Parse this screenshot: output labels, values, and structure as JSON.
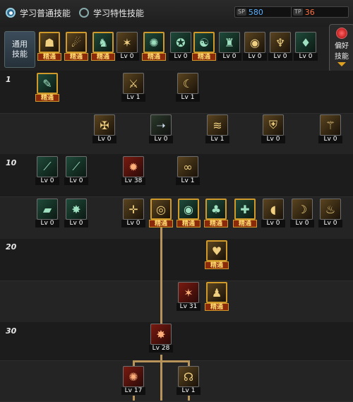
{
  "header": {
    "tab_normal": "学习普通技能",
    "tab_special": "学习特性技能",
    "sp_tag": "SP",
    "sp_value": "580",
    "tp_tag": "TP",
    "tp_value": "36"
  },
  "common": {
    "label_line1": "通用",
    "label_line2": "技能",
    "skills": [
      {
        "label": "精通"
      },
      {
        "label": "精通"
      },
      {
        "label": "精通"
      },
      {
        "label": "Lv 0"
      },
      {
        "label": "精通"
      },
      {
        "label": "Lv 0"
      },
      {
        "label": "精通"
      },
      {
        "label": "Lv 0"
      },
      {
        "label": "Lv 0"
      },
      {
        "label": "Lv 0"
      },
      {
        "label": "Lv 0"
      }
    ]
  },
  "preference": {
    "line1": "偏好",
    "line2": "技能"
  },
  "levels": {
    "l1": "1",
    "l10": "10",
    "l20": "20",
    "l30": "30"
  },
  "tree": [
    {
      "label": "精通"
    },
    {
      "label": "Lv 1"
    },
    {
      "label": "Lv 1"
    },
    {
      "label": "Lv 0"
    },
    {
      "label": "Lv 0"
    },
    {
      "label": "Lv 1"
    },
    {
      "label": "Lv 0"
    },
    {
      "label": "Lv 0"
    },
    {
      "label": "Lv 0"
    },
    {
      "label": "Lv 0"
    },
    {
      "label": "Lv 38"
    },
    {
      "label": "Lv 1"
    },
    {
      "label": "Lv 0"
    },
    {
      "label": "Lv 0"
    },
    {
      "label": "Lv 0"
    },
    {
      "label": "精通"
    },
    {
      "label": "精通"
    },
    {
      "label": "精通"
    },
    {
      "label": "精通"
    },
    {
      "label": "Lv 0"
    },
    {
      "label": "Lv 0"
    },
    {
      "label": "Lv 0"
    },
    {
      "label": "精通"
    },
    {
      "label": "Lv 31"
    },
    {
      "label": "精通"
    },
    {
      "label": "Lv 28"
    },
    {
      "label": "Lv 17"
    },
    {
      "label": "Lv 1"
    }
  ]
}
